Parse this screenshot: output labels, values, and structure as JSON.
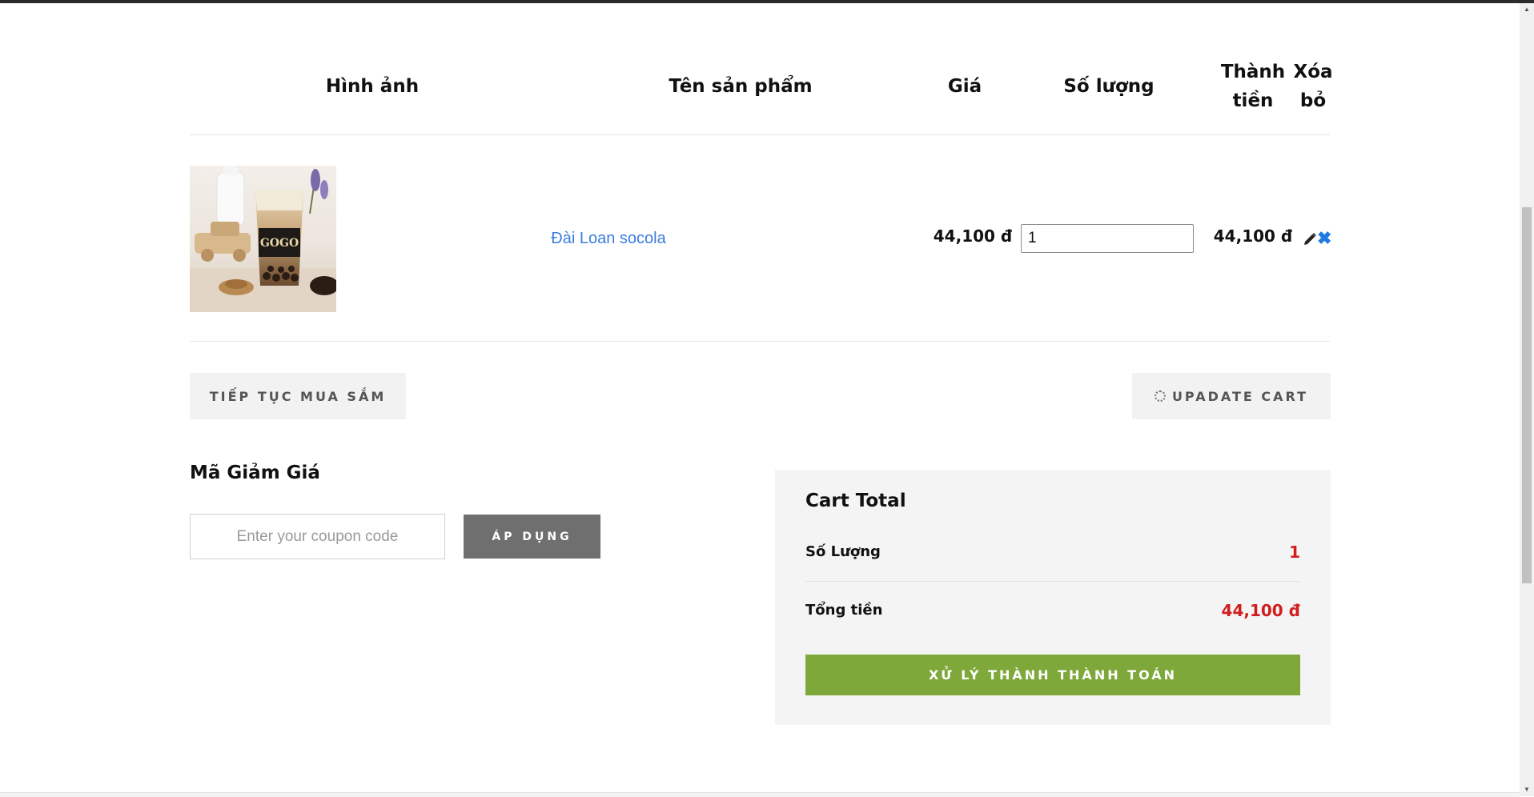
{
  "table_header": {
    "image": "Hình ảnh",
    "product_name": "Tên sản phẩm",
    "price": "Giá",
    "quantity": "Số lượng",
    "subtotal_line1": "Thành",
    "subtotal_line2": "tiền",
    "remove_line1": "Xóa",
    "remove_line2": "bỏ"
  },
  "cart_items": [
    {
      "image_icon": "milk-tea-cup-photo",
      "image_label": "GOGO",
      "name": "Đài Loan socola",
      "price": "44,100 đ",
      "quantity": "1",
      "subtotal": "44,100 đ",
      "edit_icon": "pencil-icon",
      "remove_icon": "close-icon",
      "remove_symbol": "✖"
    }
  ],
  "actions": {
    "continue_label": "TIẾP TỤC MUA SẮM",
    "update_label": "UPADATE CART",
    "update_icon": "spinner-icon"
  },
  "coupon": {
    "title": "Mã Giảm Giá",
    "placeholder": "Enter your coupon code",
    "apply_label": "ÁP DỤNG"
  },
  "cart_total": {
    "title": "Cart Total",
    "quantity_label": "Số Lượng",
    "quantity_value": "1",
    "total_label": "Tổng tiền",
    "total_value": "44,100 đ",
    "checkout_label": "XỬ LÝ THÀNH THÀNH TOÁN"
  },
  "colors": {
    "accent_green": "#7ea93a",
    "price_red": "#d11d1d",
    "link_blue": "#3b7ddd",
    "remove_blue": "#1e7be0",
    "apply_grey": "#6f6f6f"
  }
}
